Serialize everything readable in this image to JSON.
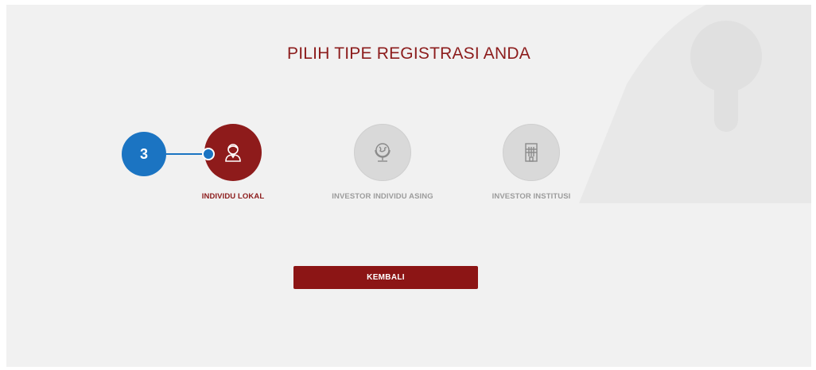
{
  "page": {
    "title": "PILIH TIPE REGISTRASI ANDA"
  },
  "options": [
    {
      "label": "INDIVIDU LOKAL",
      "state": "selected",
      "icon": "person-icon"
    },
    {
      "label": "INVESTOR INDIVIDU ASING",
      "state": "unselected",
      "icon": "globe-icon"
    },
    {
      "label": "INVESTOR INSTITUSI",
      "state": "unselected",
      "icon": "building-icon"
    }
  ],
  "actions": {
    "back_label": "KEMBALI"
  },
  "annotation": {
    "step_number": "3"
  },
  "colors": {
    "accent": "#8c1c1c",
    "panel_background": "#f1f1f1",
    "inactive_circle": "#d9d9d9",
    "inactive_text": "#9c9c9c",
    "annotation": "#1b74c2"
  }
}
